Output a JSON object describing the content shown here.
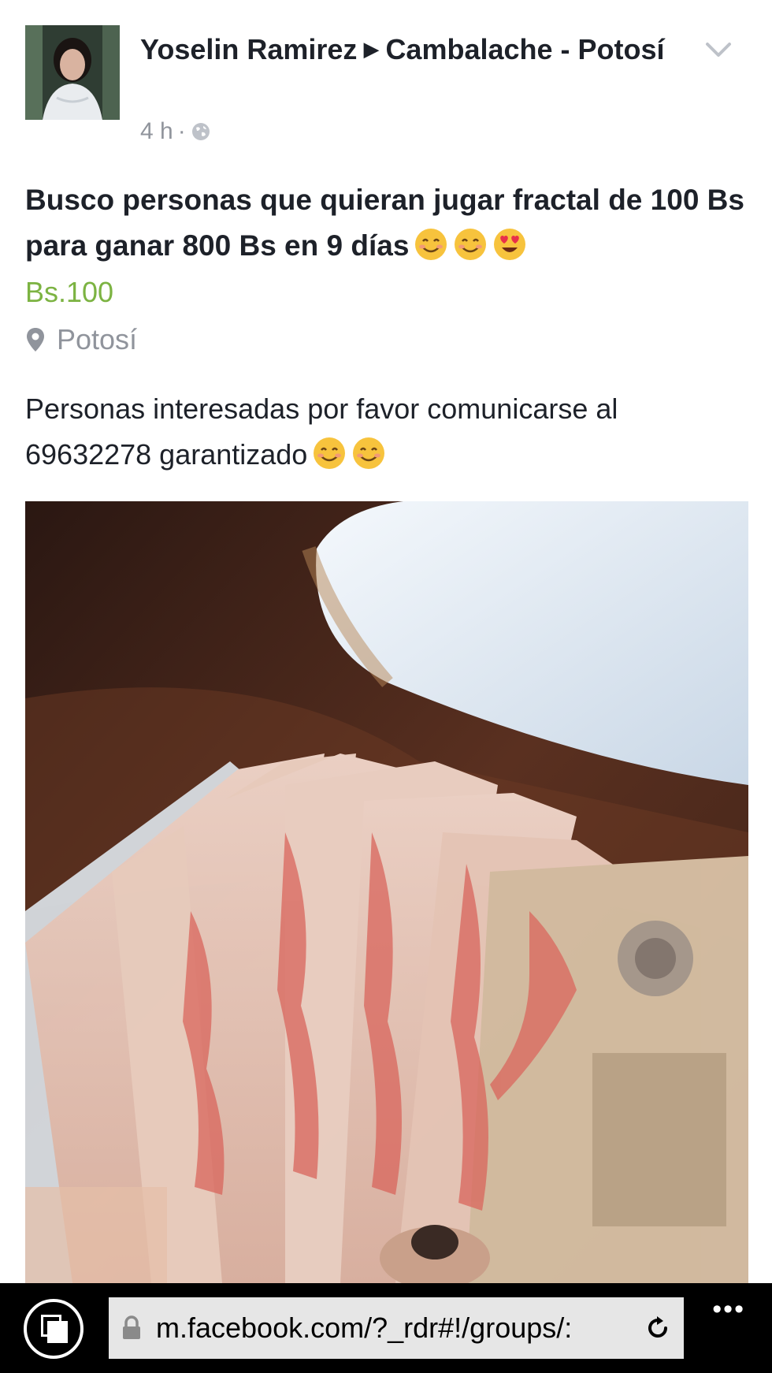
{
  "post": {
    "author": "Yoselin Ramirez",
    "arrow": "▶",
    "group": "Cambalache - Potosí",
    "time": "4 h",
    "separator": "·",
    "message": "Busco personas que quieran jugar fractal de 100 Bs para ganar 800 Bs en 9 días",
    "price": "Bs.100",
    "location": "Potosí",
    "description_line1": "Personas interesadas por favor comunicarse al",
    "description_line2": "69632278 garantizado",
    "icons": {
      "privacy": "globe-icon",
      "location": "map-pin-icon",
      "options": "chevron-down-icon",
      "emoji_smile": "smiling-face-emoji",
      "emoji_hearts": "heart-eyes-emoji"
    }
  },
  "browser": {
    "url": "m.facebook.com/?_rdr#!/groups/:",
    "more": "•••",
    "icons": {
      "tabs": "tabs-icon",
      "lock": "lock-icon",
      "reload": "reload-icon"
    }
  },
  "colors": {
    "price": "#7cb342",
    "meta": "#90949c",
    "text": "#1d2129",
    "browser_bar": "#000000",
    "url_box": "#e6e6e6"
  }
}
